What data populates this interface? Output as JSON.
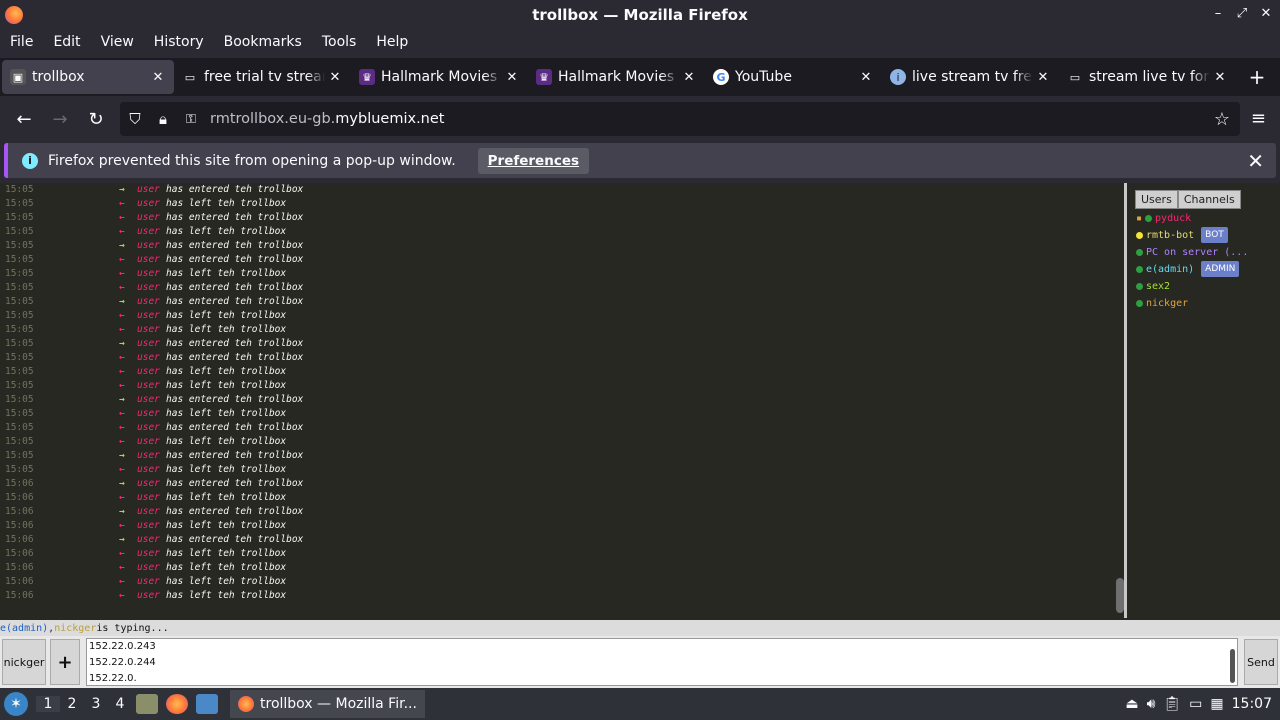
{
  "window": {
    "title": "trollbox — Mozilla Firefox",
    "controls": [
      "–",
      "⤢",
      "✕"
    ]
  },
  "menu": [
    "File",
    "Edit",
    "View",
    "History",
    "Bookmarks",
    "Tools",
    "Help"
  ],
  "tabs": [
    {
      "label": "trollbox",
      "icon": "trollbox-icon",
      "active": true
    },
    {
      "label": "free trial tv stream",
      "icon": "page-icon"
    },
    {
      "label": "Hallmark Movies Now",
      "icon": "hallmark-icon"
    },
    {
      "label": "Hallmark Movies Now",
      "icon": "hallmark-icon"
    },
    {
      "label": "YouTube",
      "icon": "google-icon"
    },
    {
      "label": "live stream tv free",
      "icon": "info-icon"
    },
    {
      "label": "stream live tv for free",
      "icon": "page-icon"
    }
  ],
  "newtab": "+",
  "nav": {
    "url_prefix": "rmtrollbox.eu-gb.",
    "url_domain": "mybluemix.net"
  },
  "notification": {
    "message": "Firefox prevented this site from opening a pop-up window.",
    "button": "Preferences"
  },
  "chat": {
    "rows": [
      {
        "time": "15:05",
        "dir": "in",
        "user": "user",
        "msg": "has entered teh trollbox"
      },
      {
        "time": "15:05",
        "dir": "out",
        "user": "user",
        "msg": "has left teh trollbox"
      },
      {
        "time": "15:05",
        "dir": "out",
        "user": "user",
        "msg": "has entered teh trollbox"
      },
      {
        "time": "15:05",
        "dir": "out",
        "user": "user",
        "msg": "has left teh trollbox"
      },
      {
        "time": "15:05",
        "dir": "in",
        "user": "user",
        "msg": "has entered teh trollbox"
      },
      {
        "time": "15:05",
        "dir": "out",
        "user": "user",
        "msg": "has entered teh trollbox"
      },
      {
        "time": "15:05",
        "dir": "out",
        "user": "user",
        "msg": "has left teh trollbox"
      },
      {
        "time": "15:05",
        "dir": "out",
        "user": "user",
        "msg": "has entered teh trollbox"
      },
      {
        "time": "15:05",
        "dir": "in",
        "user": "user",
        "msg": "has entered teh trollbox"
      },
      {
        "time": "15:05",
        "dir": "out",
        "user": "user",
        "msg": "has left teh trollbox"
      },
      {
        "time": "15:05",
        "dir": "out",
        "user": "user",
        "msg": "has left teh trollbox"
      },
      {
        "time": "15:05",
        "dir": "in",
        "user": "user",
        "msg": "has entered teh trollbox"
      },
      {
        "time": "15:05",
        "dir": "out",
        "user": "user",
        "msg": "has entered teh trollbox"
      },
      {
        "time": "15:05",
        "dir": "out",
        "user": "user",
        "msg": "has left teh trollbox"
      },
      {
        "time": "15:05",
        "dir": "out",
        "user": "user",
        "msg": "has left teh trollbox"
      },
      {
        "time": "15:05",
        "dir": "in",
        "user": "user",
        "msg": "has entered teh trollbox"
      },
      {
        "time": "15:05",
        "dir": "out",
        "user": "user",
        "msg": "has left teh trollbox"
      },
      {
        "time": "15:05",
        "dir": "out",
        "user": "user",
        "msg": "has entered teh trollbox"
      },
      {
        "time": "15:05",
        "dir": "out",
        "user": "user",
        "msg": "has left teh trollbox"
      },
      {
        "time": "15:05",
        "dir": "in",
        "user": "user",
        "msg": "has entered teh trollbox"
      },
      {
        "time": "15:05",
        "dir": "out",
        "user": "user",
        "msg": "has left teh trollbox"
      },
      {
        "time": "15:06",
        "dir": "in",
        "user": "user",
        "msg": "has entered teh trollbox"
      },
      {
        "time": "15:06",
        "dir": "out",
        "user": "user",
        "msg": "has left teh trollbox"
      },
      {
        "time": "15:06",
        "dir": "in",
        "user": "user",
        "msg": "has entered teh trollbox"
      },
      {
        "time": "15:06",
        "dir": "out",
        "user": "user",
        "msg": "has left teh trollbox"
      },
      {
        "time": "15:06",
        "dir": "in",
        "user": "user",
        "msg": "has entered teh trollbox"
      },
      {
        "time": "15:06",
        "dir": "out",
        "user": "user",
        "msg": "has left teh trollbox"
      },
      {
        "time": "15:06",
        "dir": "out",
        "user": "user",
        "msg": "has left teh trollbox"
      },
      {
        "time": "15:06",
        "dir": "out",
        "user": "user",
        "msg": "has left teh trollbox"
      },
      {
        "time": "15:06",
        "dir": "out",
        "user": "user",
        "msg": "has left teh trollbox"
      }
    ]
  },
  "sidebar": {
    "tabs": [
      "Users",
      "Channels"
    ],
    "users": [
      {
        "name": "pyduck",
        "color": "#f92672",
        "dot": "#2ea043",
        "lock": true
      },
      {
        "name": "rmtb-bot",
        "color": "#e6db74",
        "dot": "#f5e33b",
        "badge": "BOT"
      },
      {
        "name": "PC on server (...",
        "color": "#ae81ff",
        "dot": "#2ea043"
      },
      {
        "name": "e(admin)",
        "color": "#66d9ef",
        "dot": "#2ea043",
        "badge": "ADMIN"
      },
      {
        "name": "sex2",
        "color": "#a6e22e",
        "dot": "#2ea043"
      },
      {
        "name": "nickger",
        "color": "#e6a23c",
        "dot": "#2ea043"
      }
    ]
  },
  "typing": {
    "user1": "e(admin)",
    "sep": ", ",
    "user2": "nickger",
    "suffix": " is typing..."
  },
  "input": {
    "nick": "nickger",
    "plus": "+",
    "lines": [
      "152.22.0.243",
      "152.22.0.244",
      "152.22.0."
    ],
    "send": "Send"
  },
  "taskbar": {
    "workspaces": [
      "1",
      "2",
      "3",
      "4"
    ],
    "task": "trollbox — Mozilla Fir...",
    "clock": "15:07"
  }
}
